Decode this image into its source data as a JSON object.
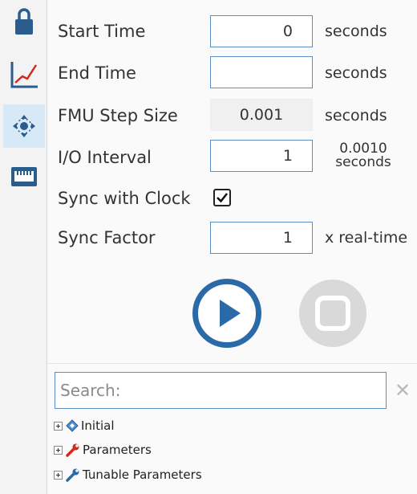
{
  "sidebar": {
    "items": [
      {
        "icon": "lock-icon"
      },
      {
        "icon": "chart-line-icon"
      },
      {
        "icon": "network-icon",
        "active": true
      },
      {
        "icon": "ethernet-port-icon"
      }
    ]
  },
  "simulation": {
    "start_time": {
      "label": "Start Time",
      "value": "0",
      "unit": "seconds"
    },
    "end_time": {
      "label": "End Time",
      "value": "",
      "unit": "seconds"
    },
    "fmu_step_size": {
      "label": "FMU Step Size",
      "value": "0.001",
      "unit": "seconds"
    },
    "io_interval": {
      "label": "I/O Interval",
      "value": "1",
      "unit_value": "0.0010",
      "unit": "seconds"
    },
    "sync_with_clock": {
      "label": "Sync with Clock",
      "checked": true
    },
    "sync_factor": {
      "label": "Sync Factor",
      "value": "1",
      "unit": "x real-time"
    }
  },
  "controls": {
    "play_icon": "play-icon",
    "stop_icon": "stop-icon",
    "stop_enabled": false
  },
  "search": {
    "placeholder": "Search:",
    "clear_icon": "close-icon"
  },
  "tree": {
    "items": [
      {
        "label": "Initial",
        "icon": "diamond-icon"
      },
      {
        "label": "Parameters",
        "icon": "wrench-red-icon"
      },
      {
        "label": "Tunable Parameters",
        "icon": "wrench-blue-icon"
      }
    ]
  },
  "colors": {
    "accent": "#2b6aa8",
    "field_border": "#5b8ec2",
    "disabled": "#d9d9d9",
    "red": "#d22a1e",
    "sidebar_active": "#d7e8f6"
  }
}
